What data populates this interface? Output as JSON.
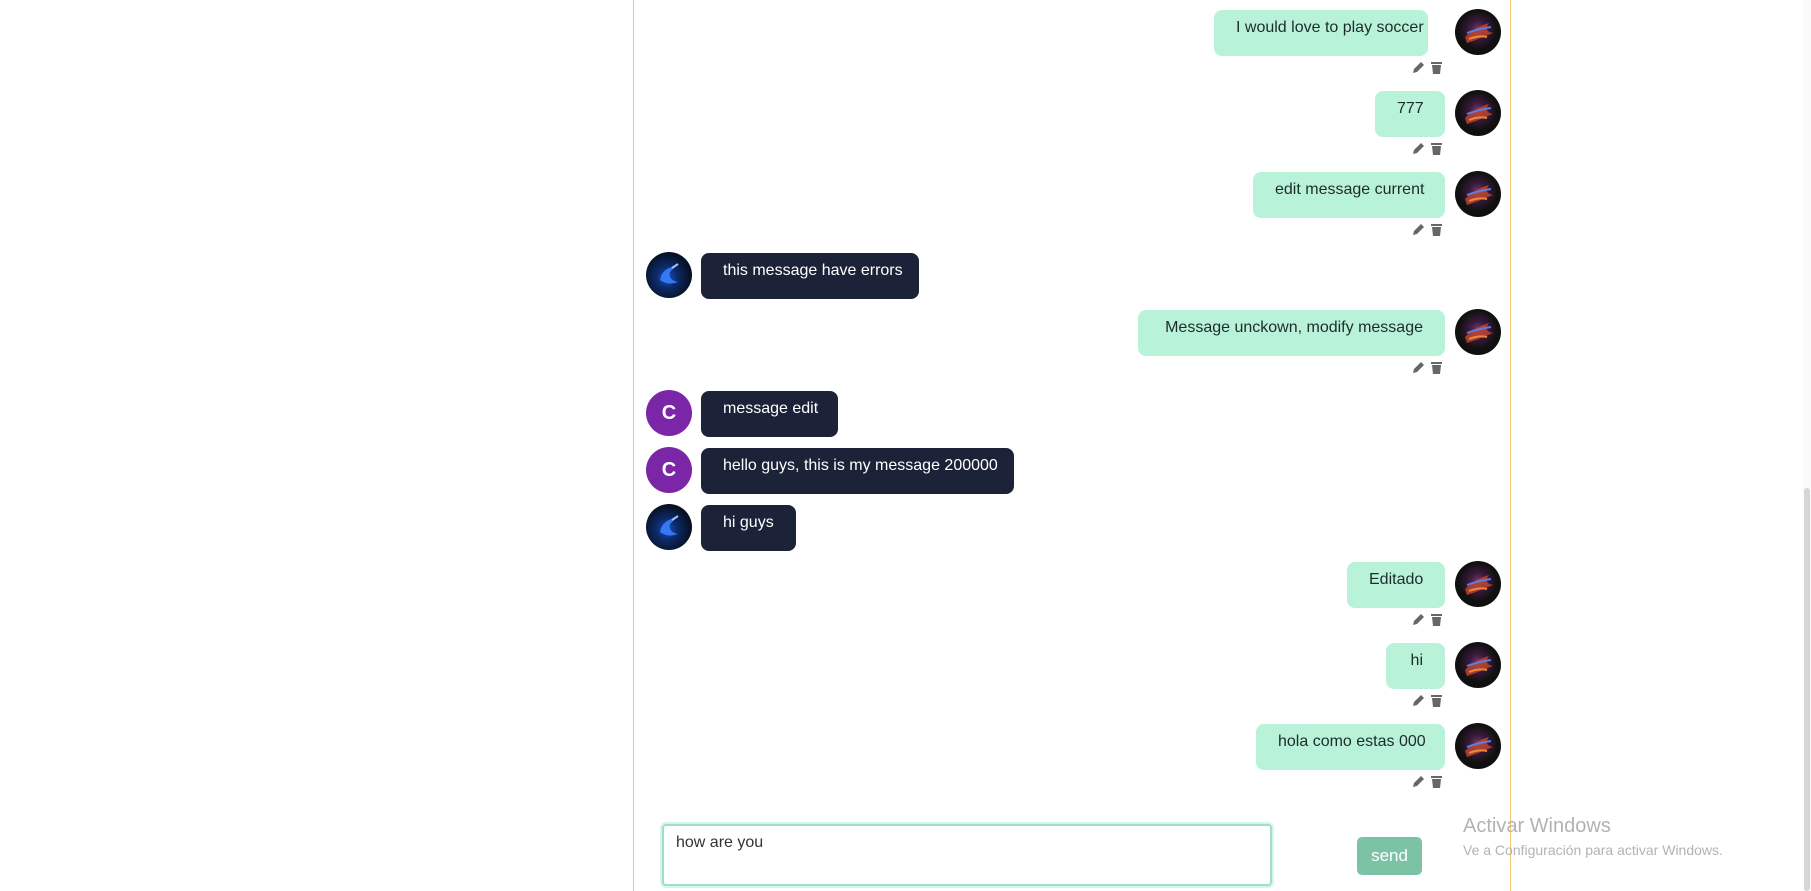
{
  "messages": [
    {
      "text": "I would love to play soccer",
      "sender": "me",
      "avatar": "flame-avatar"
    },
    {
      "text": "777",
      "sender": "me",
      "avatar": "flame-avatar"
    },
    {
      "text": "edit message current",
      "sender": "me",
      "avatar": "flame-avatar"
    },
    {
      "text": "this message have errors",
      "sender": "other",
      "avatar": "blue-avatar"
    },
    {
      "text": "Message unckown, modify message",
      "sender": "me",
      "avatar": "flame-avatar"
    },
    {
      "text": "message edit",
      "sender": "other",
      "avatar": "letter-avatar",
      "initial": "C"
    },
    {
      "text": "hello guys, this is my message 200000",
      "sender": "other",
      "avatar": "letter-avatar",
      "initial": "C"
    },
    {
      "text": "hi guys",
      "sender": "other",
      "avatar": "blue-avatar"
    },
    {
      "text": "Editado",
      "sender": "me",
      "avatar": "flame-avatar"
    },
    {
      "text": "hi",
      "sender": "me",
      "avatar": "flame-avatar"
    },
    {
      "text": "hola como estas 000",
      "sender": "me",
      "avatar": "flame-avatar"
    }
  ],
  "icons": {
    "edit": "pencil-icon",
    "delete": "trash-icon"
  },
  "composer": {
    "value": "how are you"
  },
  "send_button": {
    "label": "send"
  },
  "watermark": {
    "title": "Activar Windows",
    "subtitle": "Ve a Configuración para activar Windows."
  },
  "colors": {
    "my_bubble": "#b8f3d9",
    "their_bubble": "#1c2238",
    "panel_border": "#f3c77a",
    "send_button": "#7cc3a6",
    "letter_avatar": "#7b26a6"
  }
}
